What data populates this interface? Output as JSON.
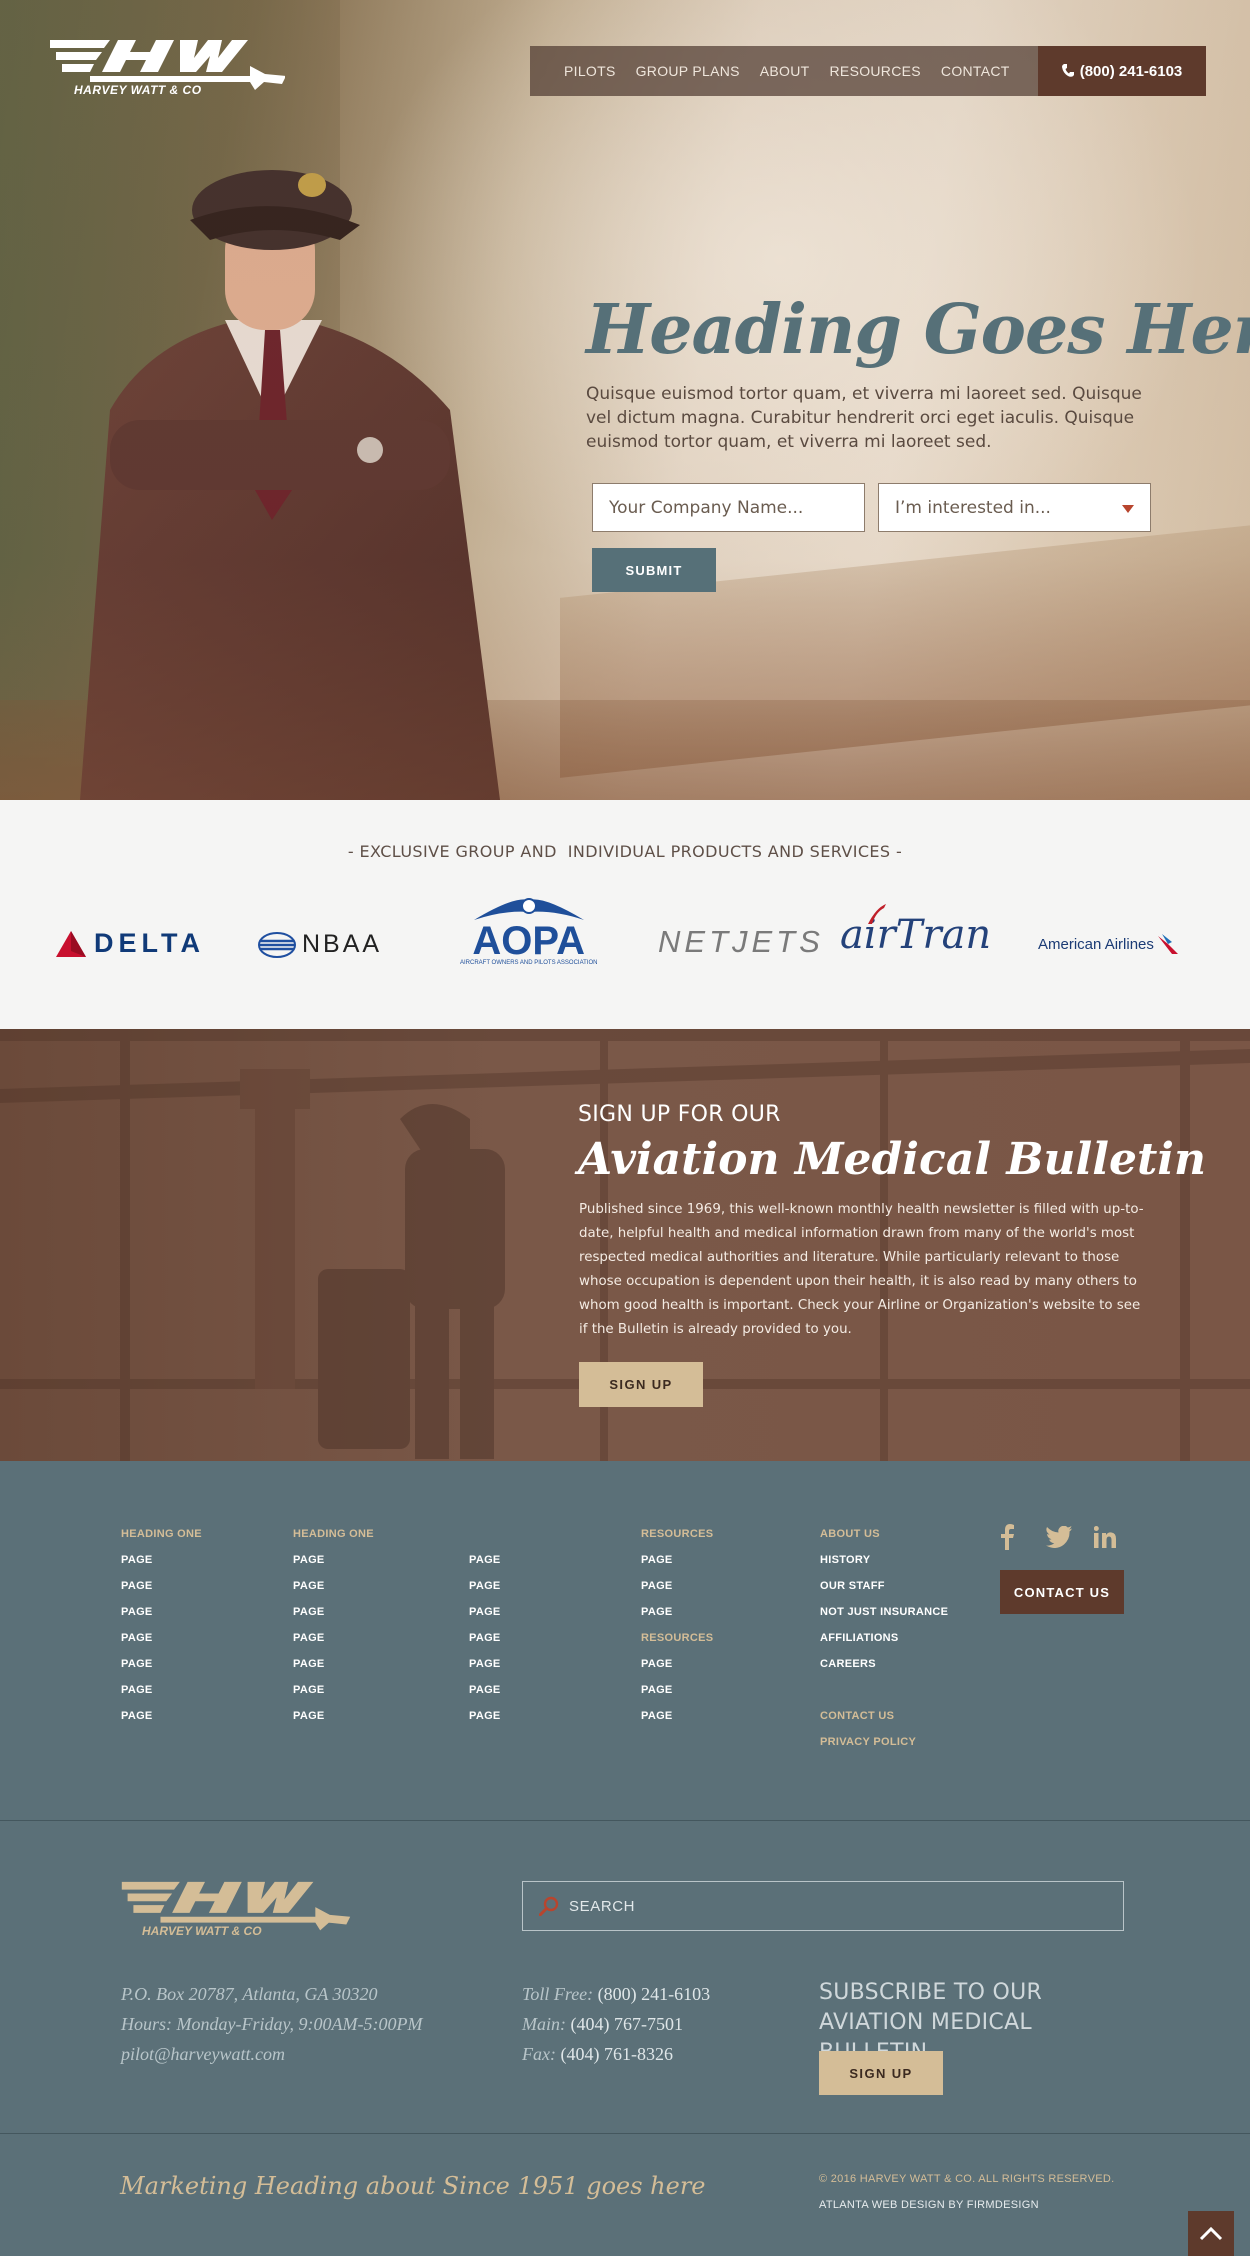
{
  "brand": {
    "name": "HARVEY WATT & CO"
  },
  "nav": {
    "items": [
      "PILOTS",
      "GROUP PLANS",
      "ABOUT",
      "RESOURCES",
      "CONTACT"
    ],
    "phone": "(800) 241-6103"
  },
  "hero": {
    "title": "Heading Goes Here",
    "body": "Quisque euismod tortor quam, et viverra mi laoreet sed. Quisque vel dictum magna. Curabitur hendrerit orci eget iaculis. Quisque euismod tortor quam, et viverra mi laoreet sed.",
    "company_placeholder": "Your Company Name...",
    "interest_select": "I’m interested in...",
    "submit_label": "SUBMIT"
  },
  "partners": {
    "title": "- EXCLUSIVE GROUP AND  INDIVIDUAL PRODUCTS AND SERVICES -",
    "logos": [
      "DELTA",
      "NBAA",
      "AOPA",
      "AIRCRAFT OWNERS AND PILOTS ASSOCIATION",
      "NETJETS",
      "airTran",
      "American Airlines"
    ]
  },
  "bulletin": {
    "subtitle": "SIGN UP FOR OUR",
    "title": "Aviation Medical Bulletin",
    "body": "Published since 1969, this well-known monthly health newsletter is filled with up-to-date, helpful health and medical information drawn from many of the world's most respected medical authorities and literature. While particularly relevant to those whose occupation is dependent upon their health, it is also read by many others to whom good health is important.  Check your Airline or Organization's website to see if the Bulletin is already provided to you.",
    "button": "SIGN UP"
  },
  "footer_links": {
    "col1": [
      "HEADING ONE",
      "PAGE",
      "PAGE",
      "PAGE",
      "PAGE",
      "PAGE",
      "PAGE",
      "PAGE"
    ],
    "col2": [
      "HEADING ONE",
      "PAGE",
      "PAGE",
      "PAGE",
      "PAGE",
      "PAGE",
      "PAGE",
      "PAGE"
    ],
    "col3": [
      "",
      "PAGE",
      "PAGE",
      "PAGE",
      "PAGE",
      "PAGE",
      "PAGE",
      "PAGE"
    ],
    "col4": [
      "RESOURCES",
      "PAGE",
      "PAGE",
      "PAGE",
      "RESOURCES",
      "PAGE",
      "PAGE",
      "PAGE"
    ],
    "col5": [
      "ABOUT US",
      "HISTORY",
      "OUR STAFF",
      "NOT JUST INSURANCE",
      "AFFILIATIONS",
      "CAREERS",
      "",
      "CONTACT US",
      "PRIVACY POLICY"
    ],
    "contact_button": "CONTACT US",
    "social": [
      "facebook-icon",
      "twitter-icon",
      "linkedin-icon"
    ]
  },
  "footer": {
    "search_placeholder": "SEARCH",
    "address": "P.O. Box 20787, Atlanta, GA 30320",
    "hours": "Hours: Monday-Friday, 9:00AM-5:00PM",
    "email": "pilot@harveywatt.com",
    "tollfree_label": "Toll Free:",
    "tollfree": "(800) 241-6103",
    "main_label": "Main:",
    "main": "(404) 767-7501",
    "fax_label": "Fax:",
    "fax": "(404) 761-8326",
    "subscribe_line1": "SUBSCRIBE TO OUR",
    "subscribe_line2": "AVIATION MEDICAL BULLETIN",
    "subscribe_button": "SIGN UP",
    "marketing": "Marketing Heading about Since 1951 goes here",
    "copyright": "© 2016 HARVEY WATT & CO. ALL RIGHTS RESERVED.",
    "credit": "ATLANTA WEB DESIGN BY FIRMDESIGN"
  },
  "colors": {
    "slate": "#567078",
    "brown": "#5e3a2c",
    "tan": "#d4bd97",
    "footer_bg": "#5b7078"
  }
}
